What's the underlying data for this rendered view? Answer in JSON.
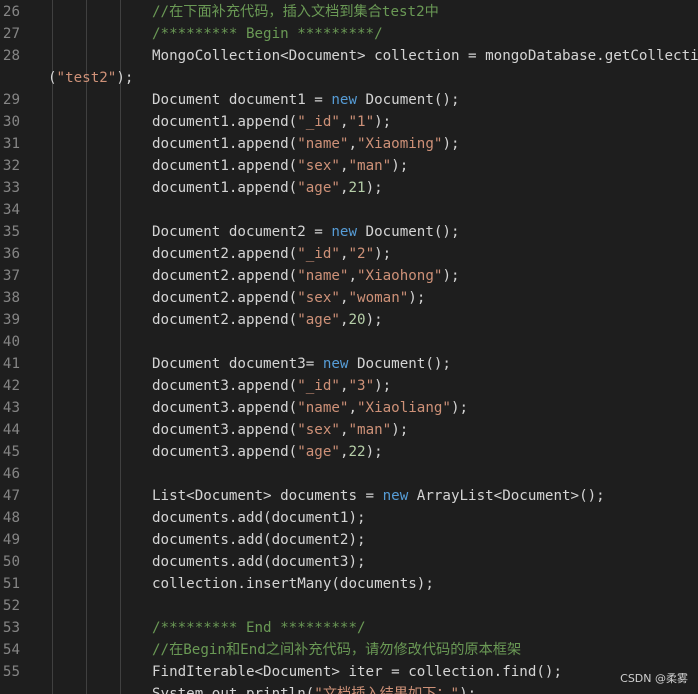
{
  "editor": {
    "colors": {
      "background": "#1e1e1e",
      "line_number": "#858585",
      "default": "#d4d4d4",
      "keyword": "#569cd6",
      "string": "#ce9178",
      "number": "#b5cea8",
      "comment": "#6a9955"
    },
    "lines": [
      {
        "num": "26",
        "tokens": [
          {
            "t": "//在下面补充代码，插入文档到集合test2中",
            "c": "com"
          }
        ]
      },
      {
        "num": "27",
        "tokens": [
          {
            "t": "/********* Begin *********/",
            "c": "com"
          }
        ]
      },
      {
        "num": "28",
        "tokens": [
          {
            "t": "MongoCollection<Document> collection = mongoDatabase.getCollection",
            "c": "plain"
          }
        ]
      },
      {
        "num": "",
        "cont": true,
        "tokens": [
          {
            "t": "(",
            "c": "plain"
          },
          {
            "t": "\"test2\"",
            "c": "str"
          },
          {
            "t": ");",
            "c": "plain"
          }
        ]
      },
      {
        "num": "29",
        "tokens": [
          {
            "t": "Document document1 = ",
            "c": "plain"
          },
          {
            "t": "new",
            "c": "kw"
          },
          {
            "t": " Document();",
            "c": "plain"
          }
        ]
      },
      {
        "num": "30",
        "tokens": [
          {
            "t": "document1.append(",
            "c": "plain"
          },
          {
            "t": "\"_id\"",
            "c": "str"
          },
          {
            "t": ",",
            "c": "plain"
          },
          {
            "t": "\"1\"",
            "c": "str"
          },
          {
            "t": ");",
            "c": "plain"
          }
        ]
      },
      {
        "num": "31",
        "tokens": [
          {
            "t": "document1.append(",
            "c": "plain"
          },
          {
            "t": "\"name\"",
            "c": "str"
          },
          {
            "t": ",",
            "c": "plain"
          },
          {
            "t": "\"Xiaoming\"",
            "c": "str"
          },
          {
            "t": ");",
            "c": "plain"
          }
        ]
      },
      {
        "num": "32",
        "tokens": [
          {
            "t": "document1.append(",
            "c": "plain"
          },
          {
            "t": "\"sex\"",
            "c": "str"
          },
          {
            "t": ",",
            "c": "plain"
          },
          {
            "t": "\"man\"",
            "c": "str"
          },
          {
            "t": ");",
            "c": "plain"
          }
        ]
      },
      {
        "num": "33",
        "tokens": [
          {
            "t": "document1.append(",
            "c": "plain"
          },
          {
            "t": "\"age\"",
            "c": "str"
          },
          {
            "t": ",",
            "c": "plain"
          },
          {
            "t": "21",
            "c": "num"
          },
          {
            "t": ");",
            "c": "plain"
          }
        ]
      },
      {
        "num": "34",
        "tokens": []
      },
      {
        "num": "35",
        "tokens": [
          {
            "t": "Document document2 = ",
            "c": "plain"
          },
          {
            "t": "new",
            "c": "kw"
          },
          {
            "t": " Document();",
            "c": "plain"
          }
        ]
      },
      {
        "num": "36",
        "tokens": [
          {
            "t": "document2.append(",
            "c": "plain"
          },
          {
            "t": "\"_id\"",
            "c": "str"
          },
          {
            "t": ",",
            "c": "plain"
          },
          {
            "t": "\"2\"",
            "c": "str"
          },
          {
            "t": ");",
            "c": "plain"
          }
        ]
      },
      {
        "num": "37",
        "tokens": [
          {
            "t": "document2.append(",
            "c": "plain"
          },
          {
            "t": "\"name\"",
            "c": "str"
          },
          {
            "t": ",",
            "c": "plain"
          },
          {
            "t": "\"Xiaohong\"",
            "c": "str"
          },
          {
            "t": ");",
            "c": "plain"
          }
        ]
      },
      {
        "num": "38",
        "tokens": [
          {
            "t": "document2.append(",
            "c": "plain"
          },
          {
            "t": "\"sex\"",
            "c": "str"
          },
          {
            "t": ",",
            "c": "plain"
          },
          {
            "t": "\"woman\"",
            "c": "str"
          },
          {
            "t": ");",
            "c": "plain"
          }
        ]
      },
      {
        "num": "39",
        "tokens": [
          {
            "t": "document2.append(",
            "c": "plain"
          },
          {
            "t": "\"age\"",
            "c": "str"
          },
          {
            "t": ",",
            "c": "plain"
          },
          {
            "t": "20",
            "c": "num"
          },
          {
            "t": ");",
            "c": "plain"
          }
        ]
      },
      {
        "num": "40",
        "tokens": []
      },
      {
        "num": "41",
        "tokens": [
          {
            "t": "Document document3= ",
            "c": "plain"
          },
          {
            "t": "new",
            "c": "kw"
          },
          {
            "t": " Document();",
            "c": "plain"
          }
        ]
      },
      {
        "num": "42",
        "tokens": [
          {
            "t": "document3.append(",
            "c": "plain"
          },
          {
            "t": "\"_id\"",
            "c": "str"
          },
          {
            "t": ",",
            "c": "plain"
          },
          {
            "t": "\"3\"",
            "c": "str"
          },
          {
            "t": ");",
            "c": "plain"
          }
        ]
      },
      {
        "num": "43",
        "tokens": [
          {
            "t": "document3.append(",
            "c": "plain"
          },
          {
            "t": "\"name\"",
            "c": "str"
          },
          {
            "t": ",",
            "c": "plain"
          },
          {
            "t": "\"Xiaoliang\"",
            "c": "str"
          },
          {
            "t": ");",
            "c": "plain"
          }
        ]
      },
      {
        "num": "44",
        "tokens": [
          {
            "t": "document3.append(",
            "c": "plain"
          },
          {
            "t": "\"sex\"",
            "c": "str"
          },
          {
            "t": ",",
            "c": "plain"
          },
          {
            "t": "\"man\"",
            "c": "str"
          },
          {
            "t": ");",
            "c": "plain"
          }
        ]
      },
      {
        "num": "45",
        "tokens": [
          {
            "t": "document3.append(",
            "c": "plain"
          },
          {
            "t": "\"age\"",
            "c": "str"
          },
          {
            "t": ",",
            "c": "plain"
          },
          {
            "t": "22",
            "c": "num"
          },
          {
            "t": ");",
            "c": "plain"
          }
        ]
      },
      {
        "num": "46",
        "tokens": []
      },
      {
        "num": "47",
        "tokens": [
          {
            "t": "List<Document> documents = ",
            "c": "plain"
          },
          {
            "t": "new",
            "c": "kw"
          },
          {
            "t": " ArrayList<Document>();",
            "c": "plain"
          }
        ]
      },
      {
        "num": "48",
        "tokens": [
          {
            "t": "documents.add(document1);",
            "c": "plain"
          }
        ]
      },
      {
        "num": "49",
        "tokens": [
          {
            "t": "documents.add(document2);",
            "c": "plain"
          }
        ]
      },
      {
        "num": "50",
        "tokens": [
          {
            "t": "documents.add(document3);",
            "c": "plain"
          }
        ]
      },
      {
        "num": "51",
        "tokens": [
          {
            "t": "collection.insertMany(documents);",
            "c": "plain"
          }
        ]
      },
      {
        "num": "52",
        "tokens": []
      },
      {
        "num": "53",
        "tokens": [
          {
            "t": "/********* End *********/",
            "c": "com"
          }
        ]
      },
      {
        "num": "54",
        "tokens": [
          {
            "t": "//在Begin和End之间补充代码，请勿修改代码的原本框架",
            "c": "com"
          }
        ]
      },
      {
        "num": "55",
        "tokens": [
          {
            "t": "FindIterable<Document> iter = collection.find();",
            "c": "plain"
          }
        ]
      },
      {
        "num": "",
        "tokens": [
          {
            "t": "System.out.println(",
            "c": "plain"
          },
          {
            "t": "\"文档插入结果如下：\"",
            "c": "str"
          },
          {
            "t": ");",
            "c": "plain"
          }
        ]
      }
    ]
  },
  "watermark": {
    "text": "CSDN @柔雾"
  }
}
